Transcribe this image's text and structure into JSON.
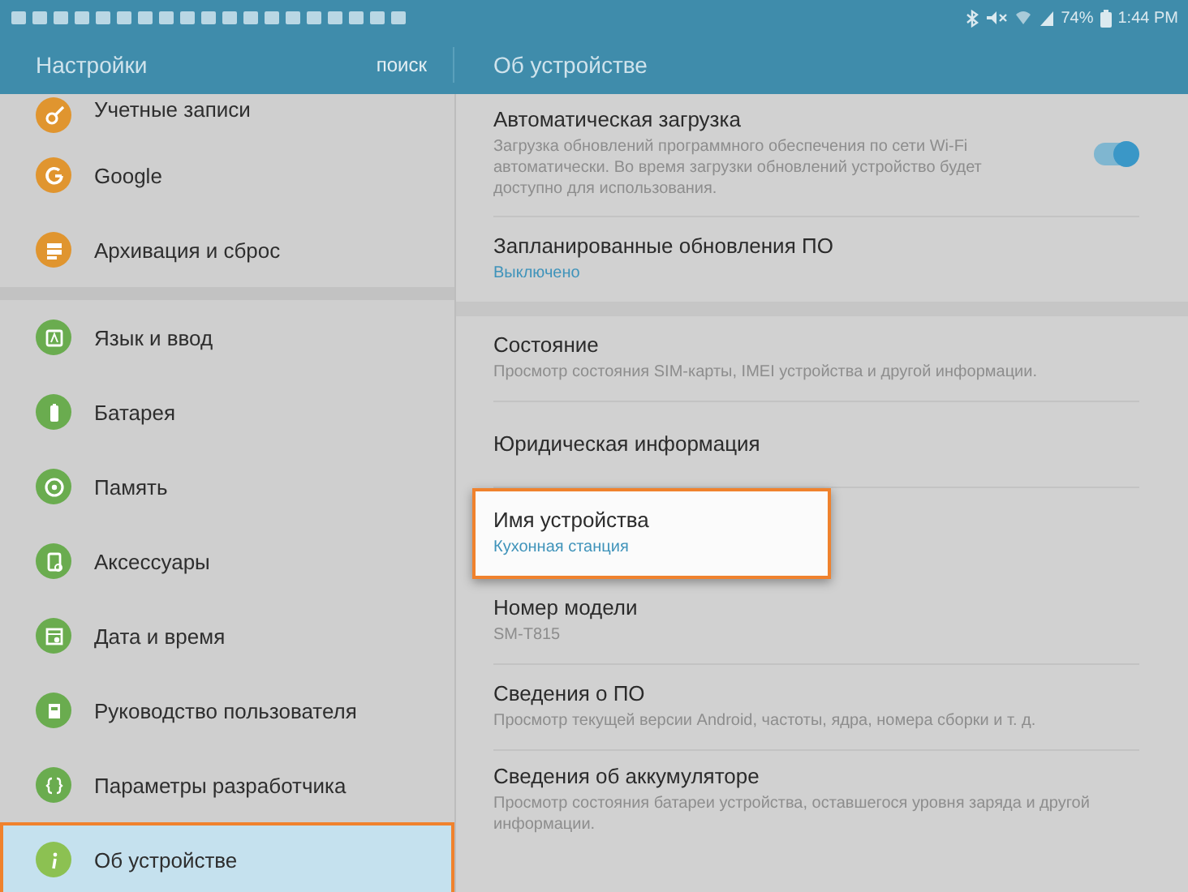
{
  "status_bar": {
    "battery": "74%",
    "time": "1:44 PM"
  },
  "header": {
    "title": "Настройки",
    "search": "поиск",
    "page_title": "Об устройстве"
  },
  "sidebar": {
    "groups": [
      {
        "items": [
          {
            "label": "Учетные записи",
            "color": "#e0952f",
            "selected": false
          },
          {
            "label": "Google",
            "color": "#e0952f",
            "selected": false
          },
          {
            "label": "Архивация и сброс",
            "color": "#e0952f",
            "selected": false
          }
        ]
      },
      {
        "items": [
          {
            "label": "Язык и ввод",
            "color": "#6aac4f",
            "selected": false
          },
          {
            "label": "Батарея",
            "color": "#6aac4f",
            "selected": false
          },
          {
            "label": "Память",
            "color": "#6aac4f",
            "selected": false
          },
          {
            "label": "Аксессуары",
            "color": "#6aac4f",
            "selected": false
          },
          {
            "label": "Дата и время",
            "color": "#6aac4f",
            "selected": false
          },
          {
            "label": "Руководство пользователя",
            "color": "#6aac4f",
            "selected": false
          },
          {
            "label": "Параметры разработчика",
            "color": "#6aac4f",
            "selected": false
          },
          {
            "label": "Об устройстве",
            "color": "#8cc152",
            "selected": true
          }
        ]
      }
    ]
  },
  "sections": [
    {
      "items": [
        {
          "kind": "switch",
          "title": "Автоматическая загрузка",
          "summary": "Загрузка обновлений программного обеспечения по сети Wi-Fi автоматически. Во время загрузки обновлений устройство будет доступно для использования.",
          "on": true,
          "highlighted": false
        },
        {
          "kind": "plain",
          "title": "Запланированные обновления ПО",
          "value": "Выключено",
          "highlighted": false
        }
      ]
    },
    {
      "items": [
        {
          "kind": "plain",
          "title": "Состояние",
          "summary": "Просмотр состояния SIM-карты, IMEI устройства и другой информации.",
          "highlighted": false
        },
        {
          "kind": "plain",
          "title": "Юридическая информация",
          "highlighted": false
        },
        {
          "kind": "plain",
          "title": "Имя устройства",
          "value": "Кухонная станция",
          "highlighted": true
        },
        {
          "kind": "plain",
          "title": "Номер модели",
          "summary": "SM-T815",
          "highlighted": false
        },
        {
          "kind": "plain",
          "title": "Сведения о ПО",
          "summary": "Просмотр текущей версии Android, частоты, ядра, номера сборки и т. д.",
          "highlighted": false
        },
        {
          "kind": "plain",
          "title": "Сведения об аккумуляторе",
          "summary": "Просмотр состояния батареи устройства, оставшегося уровня заряда и другой информации.",
          "highlighted": false
        }
      ]
    }
  ]
}
